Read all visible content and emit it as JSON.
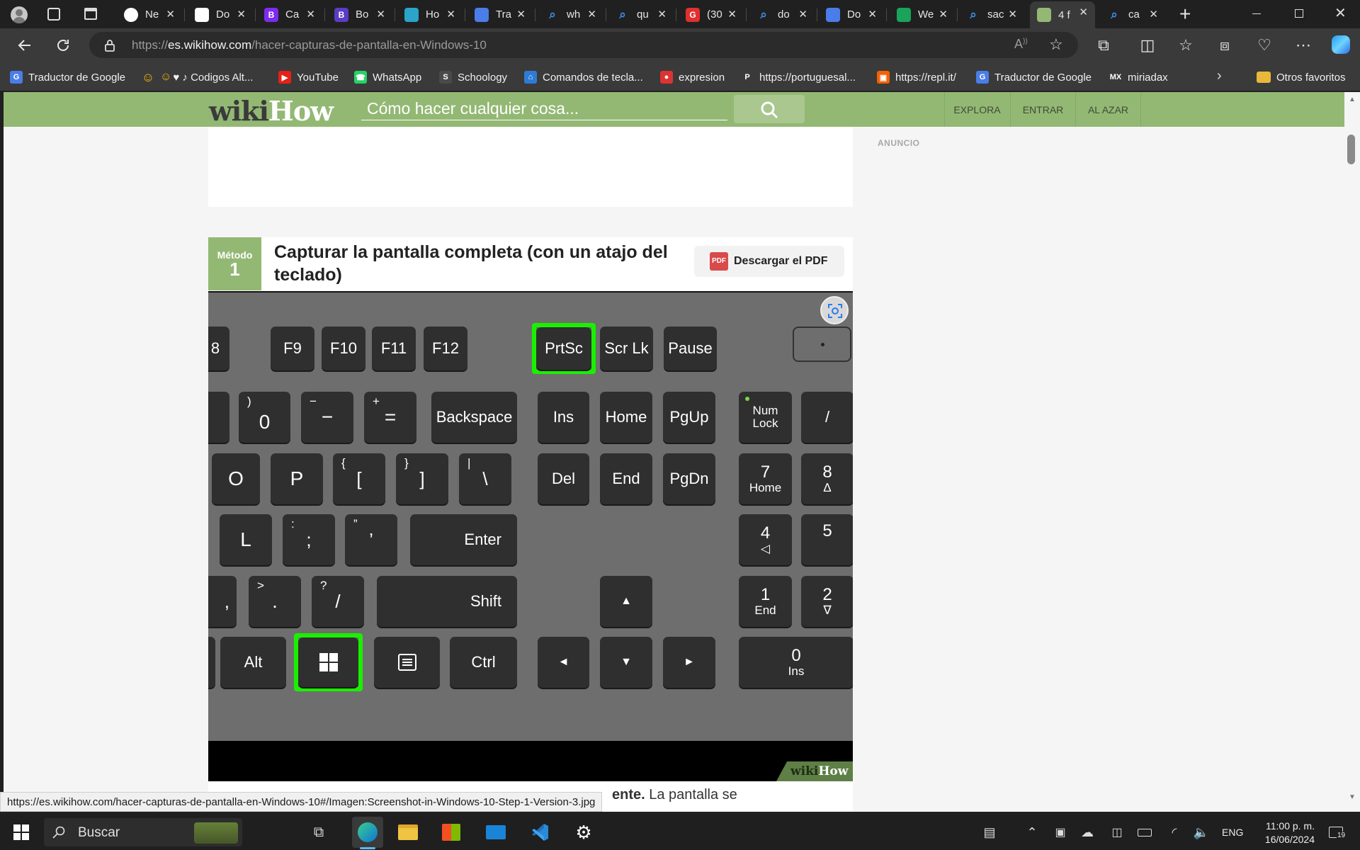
{
  "browser": {
    "tabs": [
      {
        "title": "Ne",
        "fav": "chatgpt-icon",
        "color": "#ffffff"
      },
      {
        "title": "Do",
        "fav": "document-icon",
        "color": "#ffffff"
      },
      {
        "title": "Ca",
        "fav": "B",
        "color": "#7b2cf0"
      },
      {
        "title": "Bo",
        "fav": "B",
        "color": "#5b3cc4"
      },
      {
        "title": "Ho",
        "fav": "person-icon",
        "color": "#2aa4c8"
      },
      {
        "title": "Tra",
        "fav": "translate-icon",
        "color": "#4a7de8"
      },
      {
        "title": "wh",
        "fav": "search-icon",
        "color": "#3a8ee6"
      },
      {
        "title": "qu",
        "fav": "search-icon",
        "color": "#3a8ee6"
      },
      {
        "title": "(30",
        "fav": "G",
        "color": "#e03030"
      },
      {
        "title": "do",
        "fav": "search-icon",
        "color": "#3a8ee6"
      },
      {
        "title": "Do",
        "fav": "docs-icon",
        "color": "#4a7de8"
      },
      {
        "title": "We",
        "fav": "pen-icon",
        "color": "#1aa35a"
      },
      {
        "title": "sac",
        "fav": "search-icon",
        "color": "#3a8ee6"
      },
      {
        "title": "4 f",
        "fav": "wikihow-icon",
        "color": "#93b874"
      },
      {
        "title": "ca",
        "fav": "search-icon",
        "color": "#3a8ee6"
      }
    ],
    "url_prefix": "https://",
    "url_domain": "es.wikihow.com",
    "url_path": "/hacer-capturas-de-pantalla-en-Windows-10"
  },
  "bookmarks": [
    {
      "label": "Traductor de Google",
      "icon": "G",
      "color": "#4a7de8"
    },
    {
      "label": "♥ ♪ Codigos Alt...",
      "icon": "smile",
      "color": "#f2b70f"
    },
    {
      "label": "YouTube",
      "icon": "▶",
      "color": "#e62117"
    },
    {
      "label": "WhatsApp",
      "icon": "☎",
      "color": "#25d366"
    },
    {
      "label": "Schoology",
      "icon": "S",
      "color": "#4a4a4a"
    },
    {
      "label": "Comandos de tecla...",
      "icon": "⌂",
      "color": "#2e7bd6"
    },
    {
      "label": "expresion",
      "icon": "●",
      "color": "#d33"
    },
    {
      "label": "https://portuguesal...",
      "icon": "P",
      "color": "#3a3a3a"
    },
    {
      "label": "https://repl.it/",
      "icon": "▣",
      "color": "#f26207"
    },
    {
      "label": "Traductor de Google",
      "icon": "G",
      "color": "#4a7de8"
    },
    {
      "label": "miriadax",
      "icon": "MX",
      "color": "#3a3a3a"
    }
  ],
  "bookmarks_other": "Otros favoritos",
  "wikihow": {
    "logo_wiki": "wiki",
    "logo_how": "How",
    "search_placeholder": "Cómo hacer cualquier cosa...",
    "nav": [
      "EXPLORA",
      "ENTRAR",
      "AL AZAR"
    ],
    "ad_label": "ANUNCIO",
    "method_label": "Método",
    "method_number": "1",
    "method_title": "Capturar la pantalla completa (con un atajo del teclado)",
    "pdf_button": "Descargar el PDF",
    "pdf_badge": "PDF",
    "watermark_wiki": "wiki",
    "watermark_how": "How",
    "step_text_bold": "ente.",
    "step_text_rest": " La pantalla se"
  },
  "keyboard": {
    "function_row": [
      "8",
      "F9",
      "F10",
      "F11",
      "F12",
      "PrtSc",
      "Scr Lk",
      "Pause"
    ],
    "number_row": [
      ")",
      "0",
      "−",
      "−",
      "+",
      "=",
      "Backspace",
      "Ins",
      "Home",
      "PgUp",
      "Num",
      "Lock",
      "/"
    ],
    "qwerty_row": [
      "O",
      "P",
      "{",
      "[",
      "}",
      "]",
      "|",
      "\\",
      "Del",
      "End",
      "PgDn",
      "7",
      "Home",
      "8",
      "∆"
    ],
    "home_row": [
      "L",
      ":",
      ";",
      "”",
      "’",
      "Enter",
      "4",
      "◁",
      "5"
    ],
    "shift_row": [
      ",",
      ">",
      ".",
      "?",
      "/",
      "Shift",
      "▲",
      "1",
      "End",
      "2",
      "∇"
    ],
    "bottom_row": [
      "Alt",
      "Ctrl",
      "◄",
      "▼",
      "►",
      "0",
      "Ins"
    ]
  },
  "status_url": "https://es.wikihow.com/hacer-capturas-de-pantalla-en-Windows-10#/Imagen:Screenshot-in-Windows-10-Step-1-Version-3.jpg",
  "taskbar": {
    "search_placeholder": "Buscar",
    "lang": "ENG",
    "time": "11:00 p. m.",
    "date": "16/06/2024",
    "notification_count": "19"
  }
}
